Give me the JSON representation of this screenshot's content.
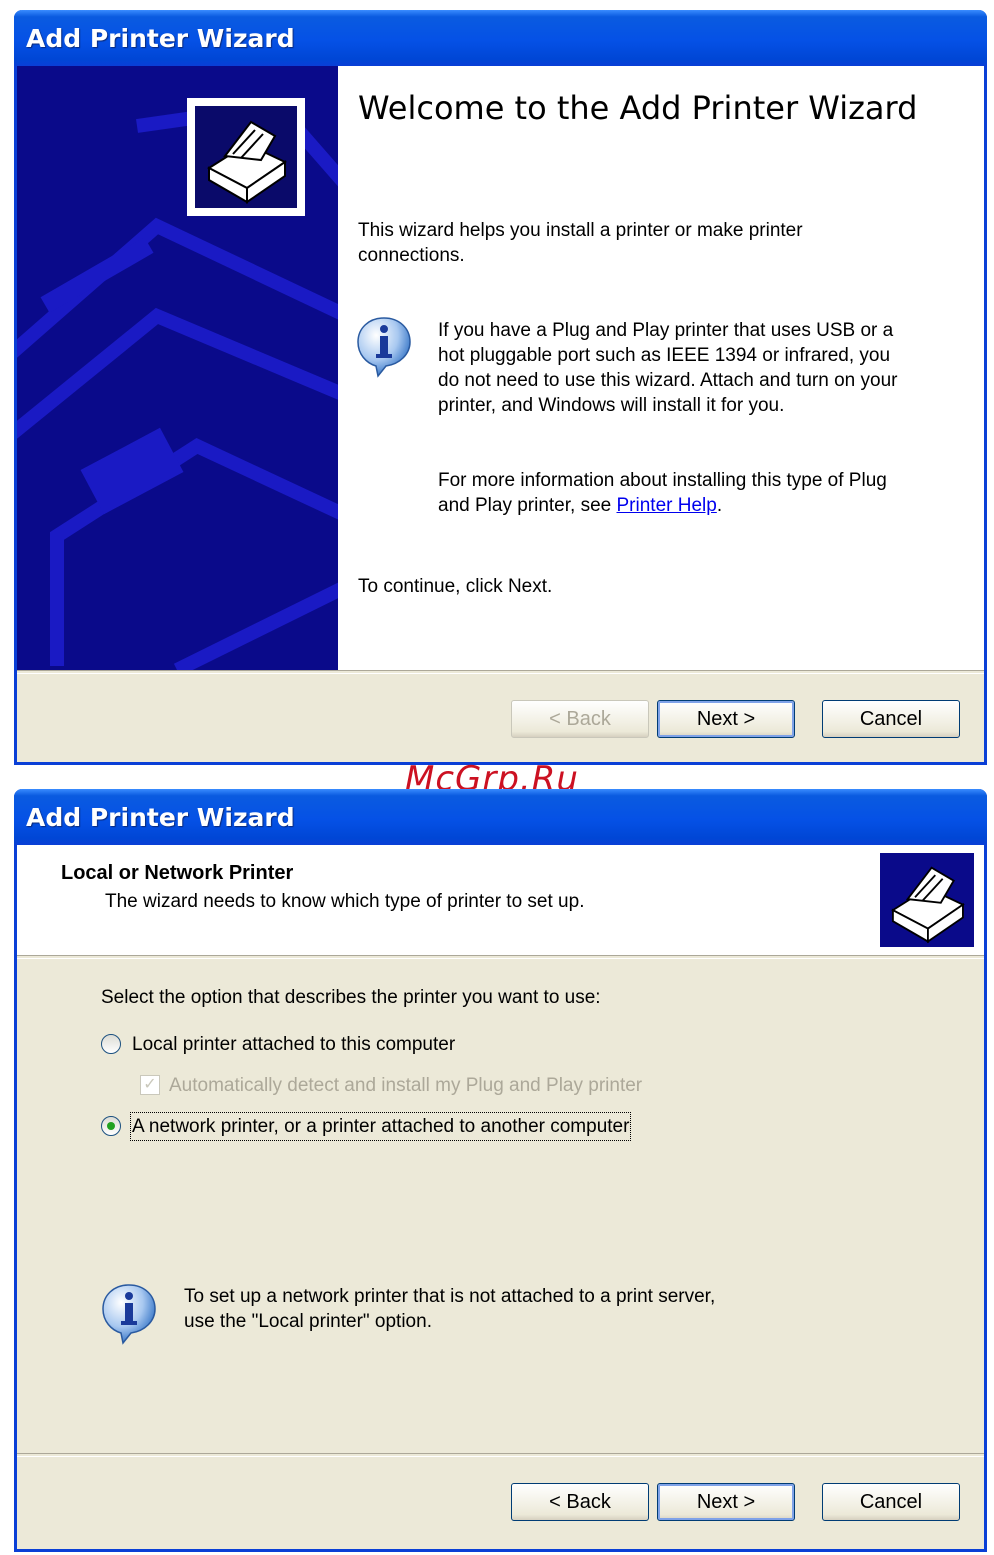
{
  "watermark": "McGrp.Ru",
  "wizard1": {
    "title": "Add Printer Wizard",
    "heading": "Welcome to the Add Printer Wizard",
    "intro": "This wizard helps you install a printer or make printer connections.",
    "info_text": "If you have a Plug and Play printer that uses USB or a hot pluggable port such as IEEE 1394 or infrared, you do not need to use this wizard. Attach and turn on your printer, and Windows will install it for you.",
    "more_info_prefix": "For more information about installing this type of Plug and Play printer, see ",
    "link_text": "Printer Help",
    "more_info_suffix": ".",
    "continue_text": "To continue, click Next.",
    "back_label": "< Back",
    "next_label": "Next >",
    "cancel_label": "Cancel",
    "back_enabled": false
  },
  "wizard2": {
    "title": "Add Printer Wizard",
    "header_title": "Local or Network Printer",
    "header_subtitle": "The wizard needs to know which type of printer to set up.",
    "prompt": "Select the option that describes the printer you want to use:",
    "options": [
      {
        "label": "Local printer attached to this computer",
        "selected": false
      },
      {
        "label": "A network printer, or a printer attached to another computer",
        "selected": true
      }
    ],
    "auto_detect_label": "Automatically detect and install my Plug and Play printer",
    "auto_detect_checked": true,
    "auto_detect_enabled": false,
    "info_text_line1": "To set up a network printer that is not attached to a print server,",
    "info_text_line2": "use the \"Local printer\" option.",
    "back_label": "< Back",
    "next_label": "Next >",
    "cancel_label": "Cancel"
  },
  "icons": {
    "printer": "printer-icon",
    "info": "info-icon"
  }
}
